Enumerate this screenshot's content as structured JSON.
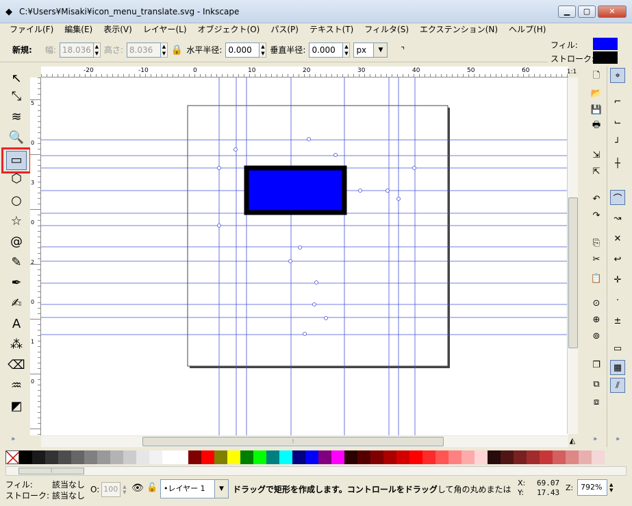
{
  "window": {
    "title": "C:¥Users¥Misaki¥icon_menu_translate.svg - Inkscape",
    "app_icon": "inkscape-icon"
  },
  "menubar": [
    "ファイル(F)",
    "編集(E)",
    "表示(V)",
    "レイヤー(L)",
    "オブジェクト(O)",
    "パス(P)",
    "テキスト(T)",
    "フィルタ(S)",
    "エクステンション(N)",
    "ヘルプ(H)"
  ],
  "tool_controls": {
    "new_label": "新規:",
    "width_label": "幅:",
    "width_value": "18.036",
    "height_label": "高さ:",
    "height_value": "8.036",
    "rx_label": "水平半径:",
    "rx_value": "0.000",
    "ry_label": "垂直半径:",
    "ry_value": "0.000",
    "unit": "px"
  },
  "fill_stroke": {
    "fill_label": "フィル:",
    "fill_color": "#0000ff",
    "stroke_label": "ストローク:",
    "stroke_color": "#000000"
  },
  "tools": [
    {
      "name": "selector-tool-icon",
      "glyph": "↖"
    },
    {
      "name": "node-tool-icon",
      "glyph": "⤡"
    },
    {
      "name": "tweak-tool-icon",
      "glyph": "≋"
    },
    {
      "name": "zoom-tool-icon",
      "glyph": "🔍"
    },
    {
      "name": "rectangle-tool-icon",
      "glyph": "▭",
      "active": true
    },
    {
      "name": "3d-box-tool-icon",
      "glyph": "⬡"
    },
    {
      "name": "ellipse-tool-icon",
      "glyph": "○"
    },
    {
      "name": "star-tool-icon",
      "glyph": "☆"
    },
    {
      "name": "spiral-tool-icon",
      "glyph": "@"
    },
    {
      "name": "pencil-tool-icon",
      "glyph": "✎"
    },
    {
      "name": "pen-tool-icon",
      "glyph": "✒"
    },
    {
      "name": "calligraphy-tool-icon",
      "glyph": "✍"
    },
    {
      "name": "text-tool-icon",
      "glyph": "A"
    },
    {
      "name": "spray-tool-icon",
      "glyph": "⁂"
    },
    {
      "name": "eraser-tool-icon",
      "glyph": "⌫"
    },
    {
      "name": "paint-bucket-tool-icon",
      "glyph": "♒"
    },
    {
      "name": "gradient-tool-icon",
      "glyph": "◩"
    }
  ],
  "more_tools": "»",
  "ruler": {
    "h_labels": [
      "-20",
      "-10",
      "0",
      "10",
      "20",
      "30",
      "40",
      "50",
      "60"
    ],
    "v_labels": [
      "5",
      "0",
      "3",
      "0",
      "2",
      "0",
      "1",
      "0"
    ]
  },
  "commands": [
    "new-document-icon",
    "open-icon",
    "save-icon",
    "print-icon",
    "import-icon",
    "export-icon",
    "undo-icon",
    "redo-icon",
    "copy-icon",
    "cut-icon",
    "paste-icon",
    "zoom-selection-icon",
    "zoom-drawing-icon",
    "zoom-page-icon",
    "duplicate-icon",
    "group-icon",
    "ungroup-icon"
  ],
  "command_glyphs": [
    "🗋",
    "📂",
    "💾",
    "🖶",
    "⇲",
    "⇱",
    "↶",
    "↷",
    "⎘",
    "✂",
    "📋",
    "⊙",
    "⊕",
    "⊚",
    "❐",
    "⧉",
    "⧈"
  ],
  "snap": [
    "snap-toggle-icon",
    "snap-bbox-icon",
    "snap-bbox-edge-icon",
    "snap-bbox-corner-icon",
    "snap-bbox-midpoint-icon",
    "snap-nodes-icon",
    "snap-path-icon",
    "snap-intersection-icon",
    "snap-smooth-icon",
    "snap-midpoint-icon",
    "snap-center-icon",
    "snap-rotation-icon",
    "snap-page-icon",
    "snap-grid-icon",
    "snap-guide-icon"
  ],
  "snap_glyphs": [
    "⌖",
    "⌐",
    "⌙",
    "┘",
    "┼",
    "⌒",
    "↝",
    "✕",
    "↩",
    "✛",
    "·",
    "±",
    "▭",
    "▦",
    "⫽"
  ],
  "palette": [
    "#000000",
    "#1a1a1a",
    "#333333",
    "#4d4d4d",
    "#666666",
    "#808080",
    "#999999",
    "#b3b3b3",
    "#cccccc",
    "#e6e6e6",
    "#f2f2f2",
    "#ffffff",
    "#ffffff",
    "#800000",
    "#ff0000",
    "#808000",
    "#ffff00",
    "#008000",
    "#00ff00",
    "#008080",
    "#00ffff",
    "#000080",
    "#0000ff",
    "#800080",
    "#ff00ff",
    "#2b0000",
    "#550000",
    "#800000",
    "#aa0000",
    "#d40000",
    "#ff0000",
    "#ff2a2a",
    "#ff5555",
    "#ff8080",
    "#ffaaaa",
    "#ffd5d5",
    "#280b0b",
    "#501616",
    "#782121",
    "#a02c2c",
    "#c83737",
    "#d35f5f",
    "#de8787",
    "#e9afaf",
    "#f4d7d7"
  ],
  "status": {
    "fill_label": "フィル:",
    "fill_value": "該当なし",
    "stroke_label": "ストローク:",
    "stroke_value": "該当なし",
    "opacity_label": "O:",
    "opacity_value": "100",
    "layer": "•レイヤー 1",
    "message_part1": "ドラッグで矩形を作成します。",
    "message_part2": "コントロールをドラッグ",
    "message_part3": "して角の丸めまたは",
    "x_label": "X:",
    "x_value": "69.07",
    "y_label": "Y:",
    "y_value": "17.43",
    "zoom_label": "Z:",
    "zoom_value": "792%"
  }
}
